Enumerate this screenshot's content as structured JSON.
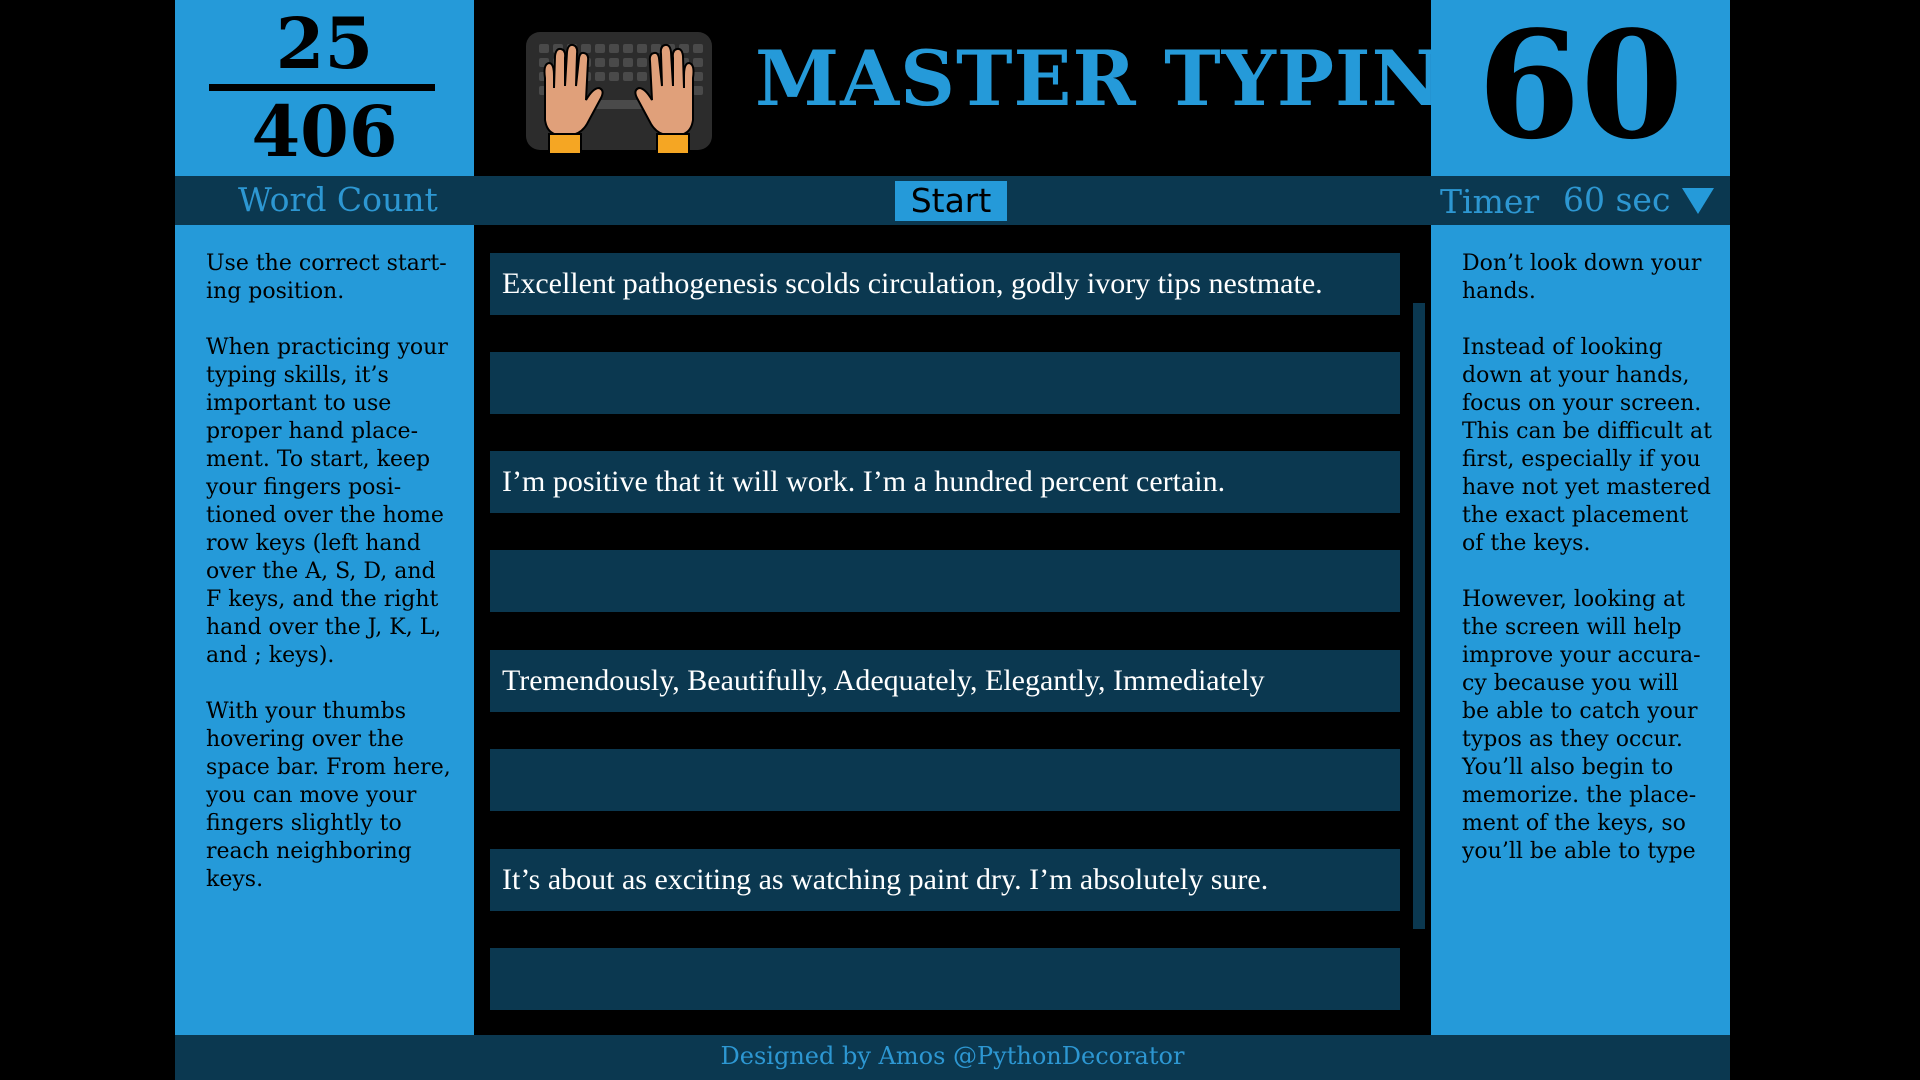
{
  "score": {
    "typed": "25",
    "total": "406"
  },
  "header": {
    "title": "MASTER TYPING"
  },
  "timer": {
    "value": "60",
    "label": "Timer",
    "selected_option": "60 sec"
  },
  "controls": {
    "word_count_label": "Word Count",
    "start_label": "Start"
  },
  "tips_left": [
    "Use the correct start-ing position.",
    "When practicing your typing skills, it’s important to use proper hand place-ment. To start, keep your fingers posi-tioned over the home row keys (left hand over the A, S, D, and F keys, and the right hand over the J, K, L, and ; keys).",
    "With your thumbs hovering over the space bar. From here, you can move your fingers slightly to reach neighboring keys."
  ],
  "tips_right": [
    "Don’t look down your hands.",
    "Instead of looking down at your hands, focus on your screen. This can be difficult at first, especially if you have not yet mastered the exact placement of the keys.",
    "However, looking at the screen will help improve your accura-cy because you will be able to catch your typos as they occur. You’ll also begin to memorize. the place-ment of the keys, so you’ll be able to type"
  ],
  "typing_lines": [
    {
      "prompt": "Excellent pathogenesis scolds circulation, godly ivory tips nestmate.",
      "input": ""
    },
    {
      "prompt": "I’m positive that it will work. I’m a hundred percent certain.",
      "input": ""
    },
    {
      "prompt": "Tremendously, Beautifully, Adequately, Elegantly, Immediately",
      "input": ""
    },
    {
      "prompt": "It’s about as exciting as watching paint dry. I’m absolutely sure.",
      "input": ""
    }
  ],
  "footer": {
    "credit": "Designed by Amos @PythonDecorator"
  },
  "colors": {
    "accent": "#259ad9",
    "panel_dark": "#0b3850",
    "background": "#000000",
    "label_text": "#2d97d2"
  },
  "icons": {
    "logo": "hands-on-keyboard-icon",
    "dropdown": "triangle-down-icon"
  }
}
